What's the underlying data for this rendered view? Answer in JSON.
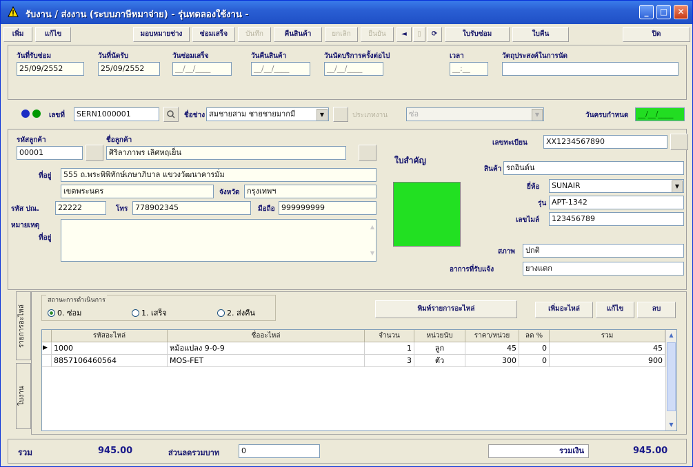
{
  "window": {
    "title": "รับงาน / ส่งงาน (ระบบภาษีหมาจ่าย) - รุ่นทดลองใช้งาน -"
  },
  "toolbar": {
    "add": "เพิ่ม",
    "edit": "แก้ไข",
    "assign": "มอบหมายช่าง",
    "repair_done": "ซ่อมเสร็จ",
    "save": "บันทึก",
    "return_goods": "คืนสินค้า",
    "cancel": "ยกเลิก",
    "confirm": "ยืนยัน",
    "repair_slip": "ใบรับซ่อม",
    "return_slip": "ใบคืน",
    "close": "ปิด"
  },
  "dates": {
    "received_label": "วันที่รับซ่อม",
    "received_value": "25/09/2552",
    "appointment_label": "วันที่นัดรับ",
    "appointment_value": "25/09/2552",
    "repair_done_label": "วันซ่อมเสร็จ",
    "repair_done_value": "__/__/____",
    "returned_label": "วันคืนสินค้า",
    "returned_value": "__/__/____",
    "next_service_label": "วันนัดบริการครั้งต่อไป",
    "next_service_value": "__/__/____",
    "time_label": "เวลา",
    "time_value": "__:__",
    "purpose_label": "วัตถุประสงค์ในการนัด",
    "purpose_value": ""
  },
  "job": {
    "number_label": "เลขที่",
    "number_value": "SERN1000001",
    "technician_label": "ชื่อช่าง",
    "technician_value": "สมชายสาม ชายชายมากมี",
    "type_label": "ประเภทงาน",
    "type_value": "ซ่อ",
    "due_label": "วันครบกำหนด",
    "due_value": "__/__/____",
    "status_color_green": "#009900",
    "status_color_blue": "#1a2dc4",
    "due_color": "#22dd22"
  },
  "customer": {
    "code_label": "รหัสลูกค้า",
    "code_value": "00001",
    "name_label": "ชื่อลูกค้า",
    "name_value": "ศิริลาภาพร เลิศหฤเย็น",
    "address_label": "ที่อยู่",
    "address_line1": "555 ถ.พระพิพิทักษ์เกษาภิบาล แขวงวัฒนาคารมั่ม",
    "address_line2": "เขตพระนคร",
    "province_label": "จังหวัด",
    "province_value": "กรุงเทพฯ",
    "postal_label": "รหัส ปณ.",
    "postal_value": "22222",
    "phone_label": "โทร",
    "phone_value": "778902345",
    "mobile_label": "มือถือ",
    "mobile_value": "999999999",
    "note_label": "หมายเหตุ",
    "note_sub": "ที่อยู่"
  },
  "center": {
    "important_label": "ใบสำคัญ",
    "status_color": "#22e022"
  },
  "product": {
    "serial_label": "เลขทะเบียน",
    "serial_value": "XX1234567890",
    "product_label": "สินค้า",
    "product_value": "รถอินด์น",
    "brand_label": "ยี่ห้อ",
    "brand_value": "SUNAIR",
    "model_label": "รุ่น",
    "model_value": "APT-1342",
    "machine_label": "เลขไมล์",
    "machine_value": "123456789",
    "condition_label": "สภาพ",
    "condition_value": "ปกติ",
    "symptom_label": "อาการที่รับแจ้ง",
    "symptom_value": "ยางแตก"
  },
  "parts": {
    "side_tab_parts": "รายการอะไหล่",
    "side_tab_other": "ใบงาน",
    "status_group_label": "สถานะการดำเนินการ",
    "radio_0": "0. ซ่อม",
    "radio_1": "1. เสร็จ",
    "radio_2": "2. ส่งคืน",
    "print_button": "พิมพ์รายการอะไหล่",
    "add_part": "เพิ่มอะไหล่",
    "edit_part": "แก้ไข",
    "delete_part": "ลบ",
    "columns": [
      "รหัสอะไหล่",
      "ชื่ออะไหล่",
      "จำนวน",
      "หน่วยนับ",
      "ราคา/หน่วย",
      "ลด %",
      "รวม"
    ],
    "rows": [
      {
        "code": "1000",
        "name": "หม้อแปลง 9-0-9",
        "qty": "1",
        "unit": "ลูก",
        "price": "45",
        "discount": "0",
        "total": "45"
      },
      {
        "code": "8857106460564",
        "name": "MOS-FET",
        "qty": "3",
        "unit": "ตัว",
        "price": "300",
        "discount": "0",
        "total": "900"
      }
    ]
  },
  "footer": {
    "total_label": "รวม",
    "total_value": "945.00",
    "discount_label": "ส่วนลดรวมบาท",
    "discount_value": "0",
    "grand_label": "รวมเงิน",
    "grand_value": "945.00"
  }
}
